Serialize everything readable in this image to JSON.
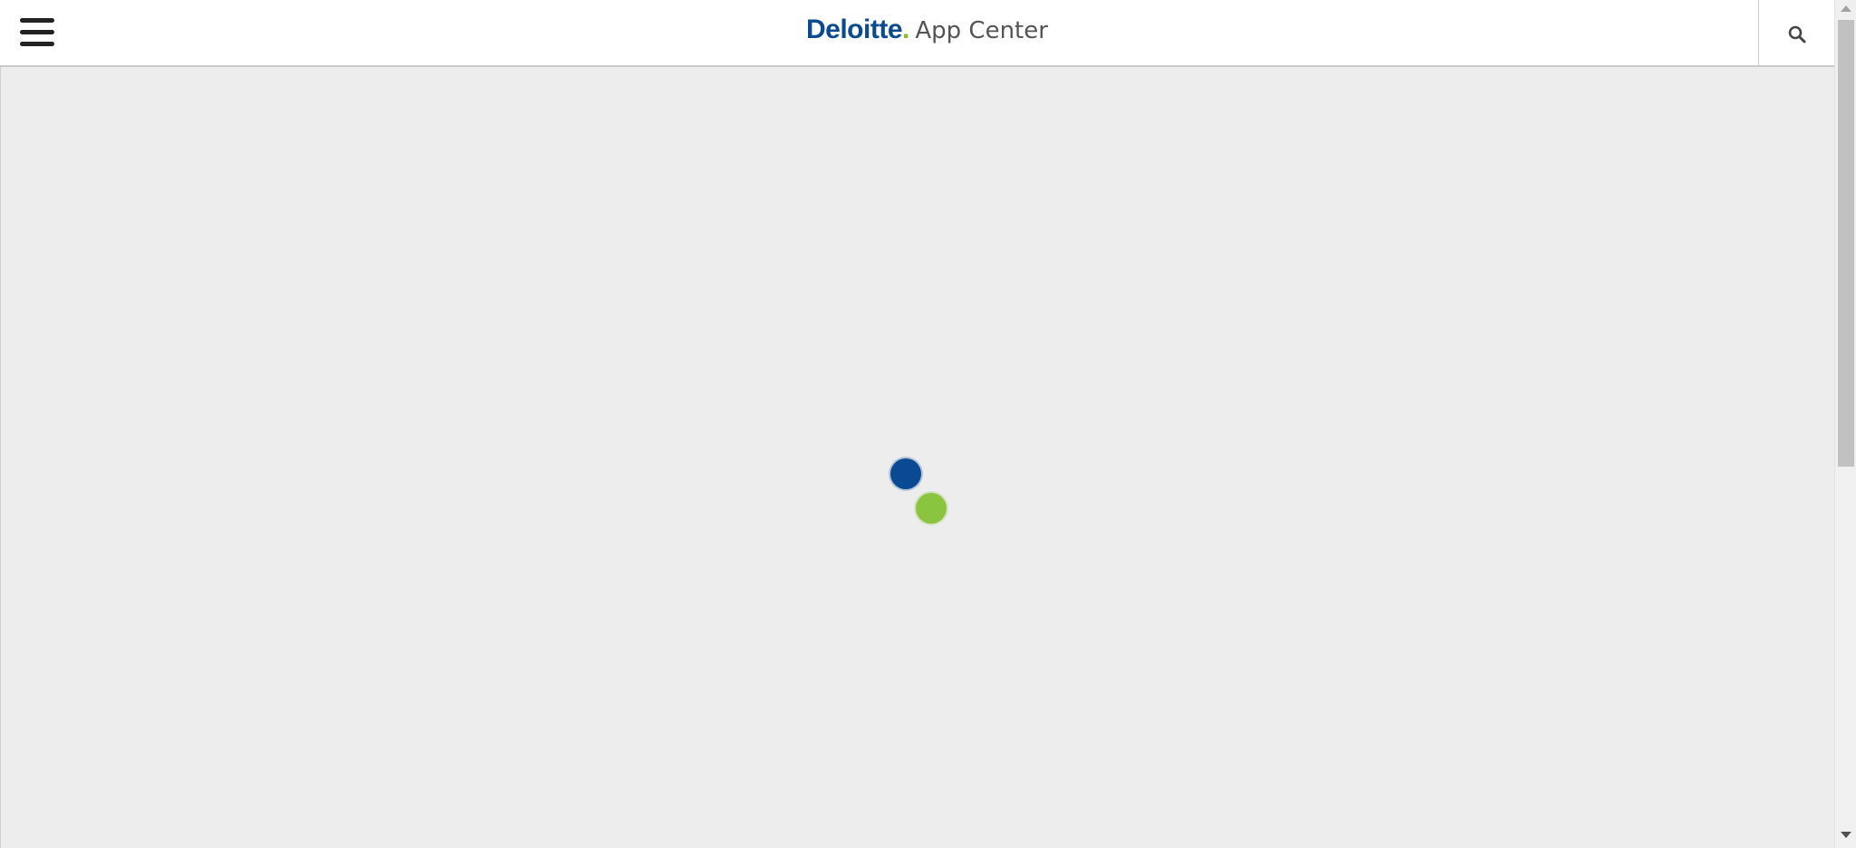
{
  "header": {
    "brand": {
      "wordmark": "Deloitte",
      "dot": ".",
      "product": "App Center"
    },
    "menu_icon": "hamburger-menu-icon",
    "search_icon": "search-icon"
  },
  "main": {
    "loading_indicator": {
      "icon": "loading-spinner-icon",
      "colors": {
        "blue": "#0a4a93",
        "green": "#8bc53f"
      }
    }
  },
  "theme": {
    "brand_blue": "#0a4a8f",
    "brand_green": "#86bc25",
    "background": "#ededed",
    "header_bg": "#ffffff"
  }
}
